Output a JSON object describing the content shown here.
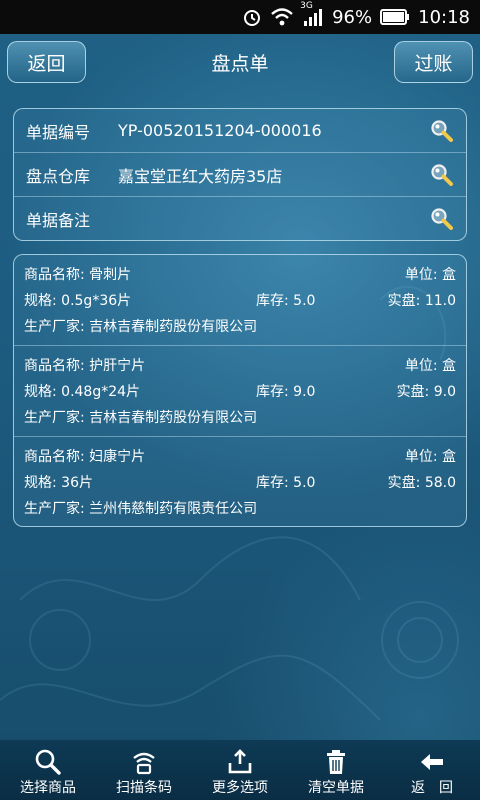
{
  "status": {
    "battery": "96%",
    "time": "10:18",
    "network": "3G"
  },
  "header": {
    "back_label": "返回",
    "title": "盘点单",
    "post_label": "过账"
  },
  "form": {
    "rows": [
      {
        "label": "单据编号",
        "value": "YP-00520151204-000016"
      },
      {
        "label": "盘点仓库",
        "value": "嘉宝堂正红大药房35店"
      },
      {
        "label": "单据备注",
        "value": ""
      }
    ]
  },
  "items": [
    {
      "name": "商品名称: 骨刺片",
      "unit": "单位: 盒",
      "spec": "规格: 0.5g*36片",
      "stock": "库存: 5.0",
      "actual": "实盘: 11.0",
      "maker": "生产厂家: 吉林吉春制药股份有限公司"
    },
    {
      "name": "商品名称: 护肝宁片",
      "unit": "单位: 盒",
      "spec": "规格: 0.48g*24片",
      "stock": "库存: 9.0",
      "actual": "实盘: 9.0",
      "maker": "生产厂家: 吉林吉春制药股份有限公司"
    },
    {
      "name": "商品名称: 妇康宁片",
      "unit": "单位: 盒",
      "spec": "规格: 36片",
      "stock": "库存: 5.0",
      "actual": "实盘: 58.0",
      "maker": "生产厂家: 兰州伟慈制药有限责任公司"
    }
  ],
  "toolbar": {
    "items": [
      {
        "label": "选择商品",
        "icon": "search-icon"
      },
      {
        "label": "扫描条码",
        "icon": "scan-icon"
      },
      {
        "label": "更多选项",
        "icon": "upload-icon"
      },
      {
        "label": "清空单据",
        "icon": "trash-icon"
      },
      {
        "label": "返　回",
        "icon": "back-arrow-icon"
      }
    ]
  },
  "colors": {
    "status_bar": "#0b0b0b",
    "background": "#1d5c80",
    "toolbar": "#0e3a55",
    "border": "#bee1f0"
  }
}
